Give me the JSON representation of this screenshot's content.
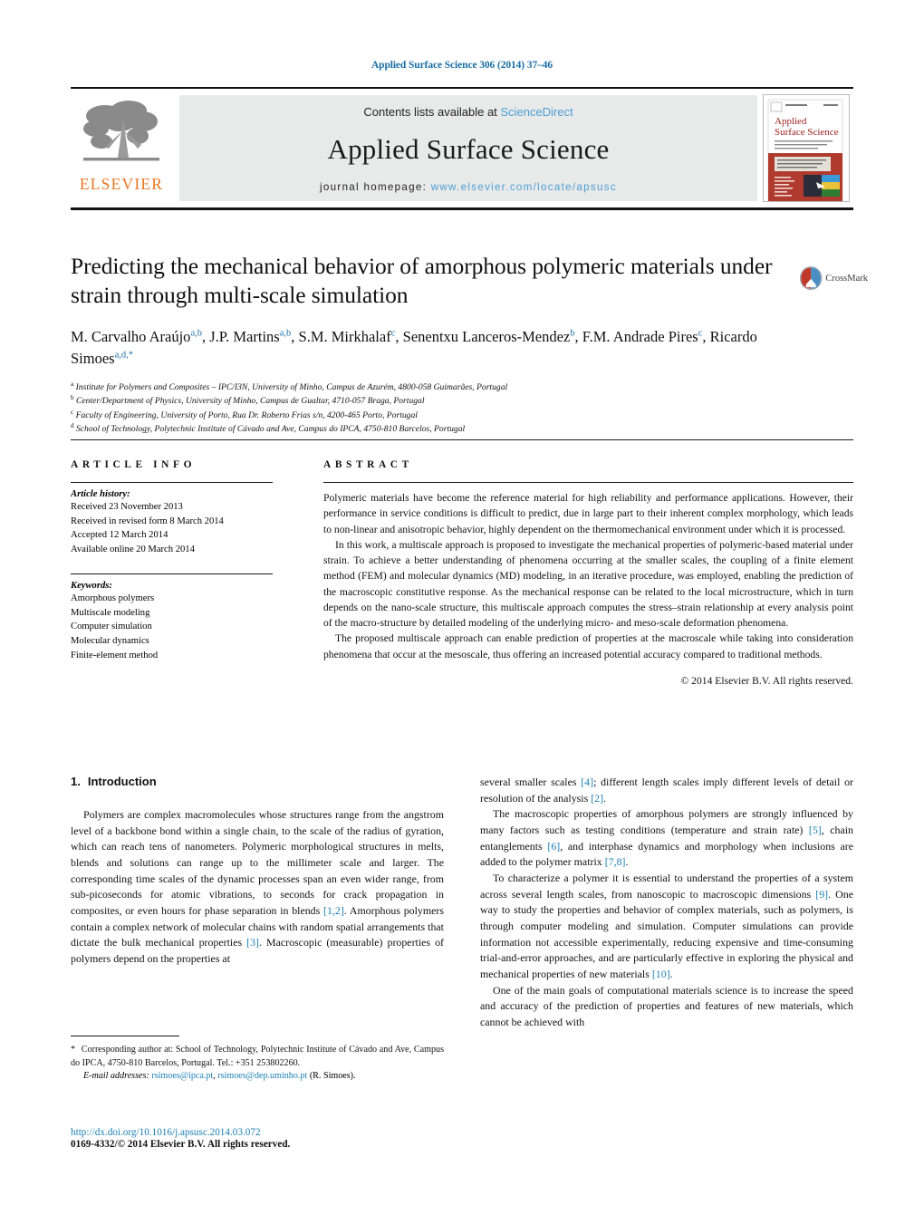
{
  "running_head": "Applied Surface Science 306 (2014) 37–46",
  "masthead": {
    "contents_prefix": "Contents lists available at ",
    "sciencedirect": "ScienceDirect",
    "journal_title": "Applied Surface Science",
    "homepage_prefix": "journal homepage:",
    "homepage_url": "www.elsevier.com/locate/apsusc",
    "publisher_wordmark": "ELSEVIER",
    "publisher_color": "#E87722",
    "link_color": "#4b9fd5",
    "cover": {
      "title_line1": "Applied",
      "title_line2": "Surface Science"
    }
  },
  "crossmark": {
    "label": "CrossMark"
  },
  "article": {
    "title": "Predicting the mechanical behavior of amorphous polymeric materials under strain through multi-scale simulation",
    "authors_html": "M. Carvalho Araújo<sup>a,b</sup>, J.P. Martins<sup>a,b</sup>, S.M. Mirkhalaf<sup>c</sup>, Senentxu Lanceros-Mendez<sup>b</sup>, F.M. Andrade Pires<sup>c</sup>, Ricardo Simoes<sup>a,d,*</sup>",
    "affiliations": [
      {
        "marker": "a",
        "text": "Institute for Polymers and Composites – IPC/I3N, University of Minho, Campus de Azurém, 4800-058 Guimarães, Portugal"
      },
      {
        "marker": "b",
        "text": "Center/Department of Physics, University of Minho, Campus de Gualtar, 4710-057 Braga, Portugal"
      },
      {
        "marker": "c",
        "text": "Faculty of Engineering, University of Porto, Rua Dr. Roberto Frias s/n, 4200-465 Porto, Portugal"
      },
      {
        "marker": "d",
        "text": "School of Technology, Polytechnic Institute of Cávado and Ave, Campus do IPCA, 4750-810 Barcelos, Portugal"
      }
    ]
  },
  "article_info": {
    "heading": "ARTICLE INFO",
    "history_label": "Article history:",
    "history": [
      "Received 23 November 2013",
      "Received in revised form 8 March 2014",
      "Accepted 12 March 2014",
      "Available online 20 March 2014"
    ],
    "keywords_label": "Keywords:",
    "keywords": [
      "Amorphous polymers",
      "Multiscale modeling",
      "Computer simulation",
      "Molecular dynamics",
      "Finite-element method"
    ]
  },
  "abstract": {
    "heading": "ABSTRACT",
    "paragraphs": [
      "Polymeric materials have become the reference material for high reliability and performance applications. However, their performance in service conditions is difficult to predict, due in large part to their inherent complex morphology, which leads to non-linear and anisotropic behavior, highly dependent on the thermomechanical environment under which it is processed.",
      "In this work, a multiscale approach is proposed to investigate the mechanical properties of polymeric-based material under strain. To achieve a better understanding of phenomena occurring at the smaller scales, the coupling of a finite element method (FEM) and molecular dynamics (MD) modeling, in an iterative procedure, was employed, enabling the prediction of the macroscopic constitutive response. As the mechanical response can be related to the local microstructure, which in turn depends on the nano-scale structure, this multiscale approach computes the stress–strain relationship at every analysis point of the macro-structure by detailed modeling of the underlying micro- and meso-scale deformation phenomena.",
      "The proposed multiscale approach can enable prediction of properties at the macroscale while taking into consideration phenomena that occur at the mesoscale, thus offering an increased potential accuracy compared to traditional methods."
    ],
    "copyright": "© 2014 Elsevier B.V. All rights reserved."
  },
  "introduction": {
    "number": "1.",
    "title": "Introduction",
    "left_paragraph_html": "Polymers are complex macromolecules whose structures range from the angstrom level of a backbone bond within a single chain, to the scale of the radius of gyration, which can reach tens of nanometers. Polymeric morphological structures in melts, blends and solutions can range up to the millimeter scale and larger. The corresponding time scales of the dynamic processes span an even wider range, from sub-picoseconds for atomic vibrations, to seconds for crack propagation in composites, or even hours for phase separation in blends <span class=\"ref\">[1,2]</span>. Amorphous polymers contain a complex network of molecular chains with random spatial arrangements that dictate the bulk mechanical properties <span class=\"ref\">[3]</span>. Macroscopic (measurable) properties of polymers depend on the properties at",
    "right_paragraphs_html": [
      "several smaller scales <span class=\"ref\">[4]</span>; different length scales imply different levels of detail or resolution of the analysis <span class=\"ref\">[2]</span>.",
      "The macroscopic properties of amorphous polymers are strongly influenced by many factors such as testing conditions (temperature and strain rate) <span class=\"ref\">[5]</span>, chain entanglements <span class=\"ref\">[6]</span>, and interphase dynamics and morphology when inclusions are added to the polymer matrix <span class=\"ref\">[7,8]</span>.",
      "To characterize a polymer it is essential to understand the properties of a system across several length scales, from nanoscopic to macroscopic dimensions <span class=\"ref\">[9]</span>. One way to study the properties and behavior of complex materials, such as polymers, is through computer modeling and simulation. Computer simulations can provide information not accessible experimentally, reducing expensive and time-consuming trial-and-error approaches, and are particularly effective in exploring the physical and mechanical properties of new materials <span class=\"ref\">[10]</span>.",
      "One of the main goals of computational materials science is to increase the speed and accuracy of the prediction of properties and features of new materials, which cannot be achieved with"
    ]
  },
  "footnote": {
    "corresponding_html": "<span class=\"star\">*</span> Corresponding author at: School of Technology, Polytechnic Institute of Cávado and Ave, Campus do IPCA, 4750-810 Barcelos, Portugal. Tel.: +351 253802260.",
    "email_label": "E-mail addresses:",
    "emails": [
      "rsimoes@ipca.pt",
      "rsimoes@dep.uminho.pt"
    ],
    "email_suffix": "(R. Simoes)."
  },
  "bottom": {
    "doi": "http://dx.doi.org/10.1016/j.apsusc.2014.03.072",
    "issn_line": "0169-4332/© 2014 Elsevier B.V. All rights reserved."
  }
}
